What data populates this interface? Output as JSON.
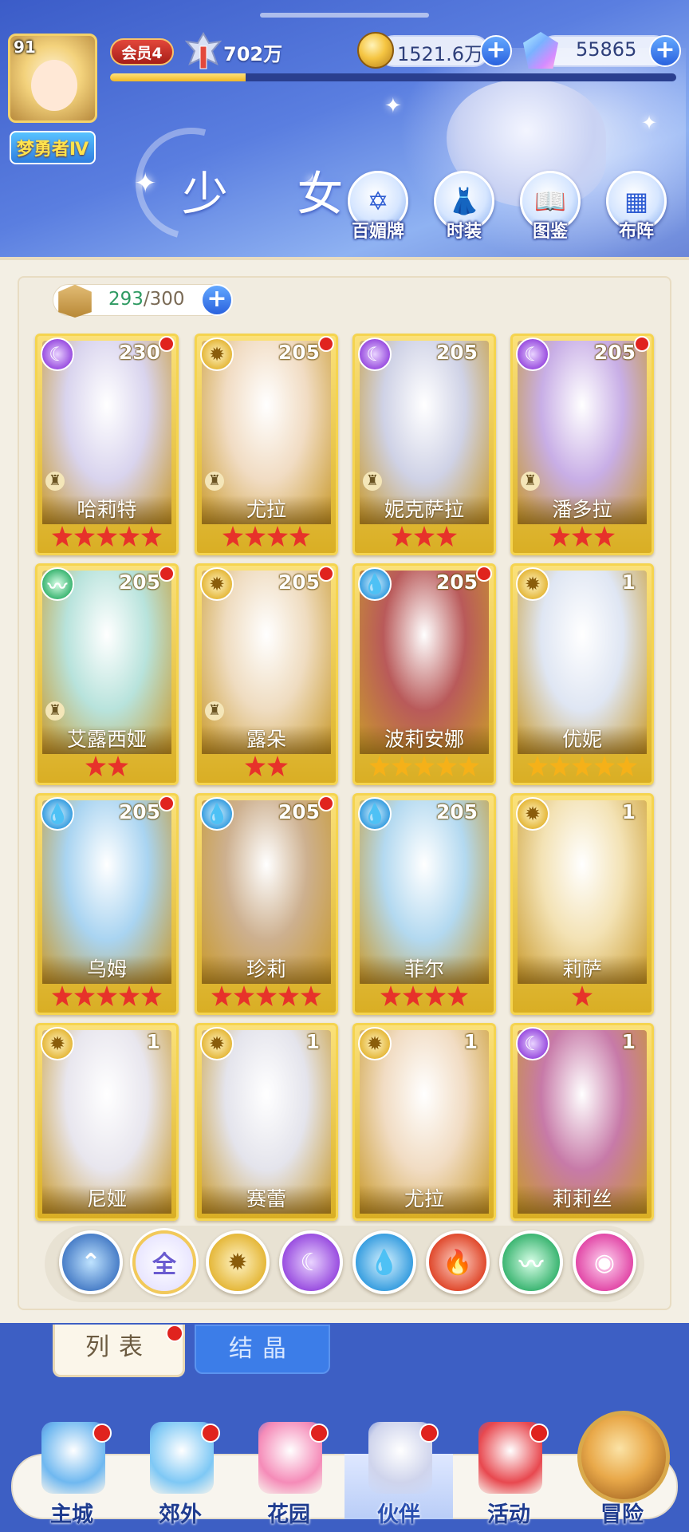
{
  "player": {
    "level": "91",
    "title": "梦勇者Ⅳ",
    "vip": "会员4",
    "power": "702万",
    "exp_fraction": 0.24
  },
  "resources": {
    "gold": "1521.6万",
    "gems": "55865"
  },
  "page": {
    "title": "少 女"
  },
  "features": [
    {
      "label": "百媚牌",
      "icon": "hexagram-card-icon"
    },
    {
      "label": "时装",
      "icon": "outfit-icon"
    },
    {
      "label": "图鉴",
      "icon": "book-icon"
    },
    {
      "label": "布阵",
      "icon": "formation-grid-icon"
    }
  ],
  "capacity": {
    "current": "293",
    "max": "/300"
  },
  "cards": [
    {
      "name": "哈莉特",
      "level": "230",
      "element": "dark",
      "stars": 5,
      "star_color": "red",
      "dot": true,
      "chess": true,
      "hue": "#d9d4ee"
    },
    {
      "name": "尤拉",
      "level": "205",
      "element": "light",
      "stars": 4,
      "star_color": "red",
      "dot": true,
      "chess": true,
      "hue": "#f1dcc3"
    },
    {
      "name": "妮克萨拉",
      "level": "205",
      "element": "dark",
      "stars": 3,
      "star_color": "red",
      "dot": false,
      "chess": true,
      "hue": "#cfd2e6"
    },
    {
      "name": "潘多拉",
      "level": "205",
      "element": "dark",
      "stars": 3,
      "star_color": "red",
      "dot": true,
      "chess": true,
      "hue": "#c8aee6"
    },
    {
      "name": "艾露西娅",
      "level": "205",
      "element": "wind",
      "stars": 2,
      "star_color": "red",
      "dot": true,
      "chess": true,
      "hue": "#b8e3dc"
    },
    {
      "name": "露朵",
      "level": "205",
      "element": "light",
      "stars": 2,
      "star_color": "red",
      "dot": true,
      "chess": true,
      "hue": "#efdcc0"
    },
    {
      "name": "波莉安娜",
      "level": "205",
      "element": "water",
      "stars": 5,
      "star_color": "gold",
      "dot": true,
      "chess": false,
      "hue": "#b95a5a"
    },
    {
      "name": "优妮",
      "level": "1",
      "element": "light",
      "stars": 5,
      "star_color": "gold",
      "dot": false,
      "chess": false,
      "hue": "#dfe6f3"
    },
    {
      "name": "乌姆",
      "level": "205",
      "element": "water",
      "stars": 5,
      "star_color": "red",
      "dot": true,
      "chess": false,
      "hue": "#a9d4f1"
    },
    {
      "name": "珍莉",
      "level": "205",
      "element": "water",
      "stars": 5,
      "star_color": "red",
      "dot": true,
      "chess": false,
      "hue": "#cdb08f"
    },
    {
      "name": "菲尔",
      "level": "205",
      "element": "water",
      "stars": 4,
      "star_color": "red",
      "dot": false,
      "chess": false,
      "hue": "#b3d9f0"
    },
    {
      "name": "莉萨",
      "level": "1",
      "element": "light",
      "stars": 1,
      "star_color": "red",
      "dot": false,
      "chess": false,
      "hue": "#f3e2b4"
    },
    {
      "name": "尼娅",
      "level": "1",
      "element": "light",
      "stars": 0,
      "star_color": "red",
      "dot": false,
      "chess": false,
      "hue": "#e8e6ee"
    },
    {
      "name": "赛蕾",
      "level": "1",
      "element": "light",
      "stars": 0,
      "star_color": "red",
      "dot": false,
      "chess": false,
      "hue": "#e4e4ec"
    },
    {
      "name": "尤拉",
      "level": "1",
      "element": "light",
      "stars": 0,
      "star_color": "red",
      "dot": false,
      "chess": false,
      "hue": "#f1dcc3"
    },
    {
      "name": "莉莉丝",
      "level": "1",
      "element": "dark",
      "stars": 0,
      "star_color": "red",
      "dot": false,
      "chess": false,
      "hue": "#c77aa8"
    }
  ],
  "filters": [
    {
      "id": "top",
      "label": "",
      "glyph": "⌃",
      "class": "elem-top"
    },
    {
      "id": "all",
      "label": "全",
      "glyph": "全",
      "class": "elem-all",
      "selected": true
    },
    {
      "id": "light",
      "label": "",
      "glyph": "✹",
      "class": "elem-light"
    },
    {
      "id": "dark",
      "label": "",
      "glyph": "☾",
      "class": "elem-dark"
    },
    {
      "id": "water",
      "label": "",
      "glyph": "💧",
      "class": "elem-water"
    },
    {
      "id": "fire",
      "label": "",
      "glyph": "🔥",
      "class": "elem-fire"
    },
    {
      "id": "wind",
      "label": "",
      "glyph": "〰",
      "class": "elem-wind"
    },
    {
      "id": "pink",
      "label": "",
      "glyph": "◉",
      "class": "elem-pink"
    }
  ],
  "tabs": {
    "list": "列表",
    "crystal": "结晶"
  },
  "nav": [
    {
      "label": "主城",
      "icon": "castle-icon",
      "dot": true,
      "color": "#6fb8f0"
    },
    {
      "label": "郊外",
      "icon": "portal-icon",
      "dot": true,
      "color": "#7ec8f5"
    },
    {
      "label": "花园",
      "icon": "heart-garden-icon",
      "dot": true,
      "color": "#f58bb8"
    },
    {
      "label": "伙伴",
      "icon": "partner-portrait-icon",
      "dot": true,
      "color": "#cfd4ec"
    },
    {
      "label": "活动",
      "icon": "gift-box-icon",
      "dot": true,
      "color": "#e8484f"
    },
    {
      "label": "冒险",
      "icon": "compass-icon",
      "dot": false,
      "color": "#e9a94a"
    }
  ],
  "colors": {
    "header_blue": "#3b5cc8",
    "card_gold": "#f5d44f",
    "notification_red": "#e0231e",
    "panel_bg": "#f3efe4"
  }
}
